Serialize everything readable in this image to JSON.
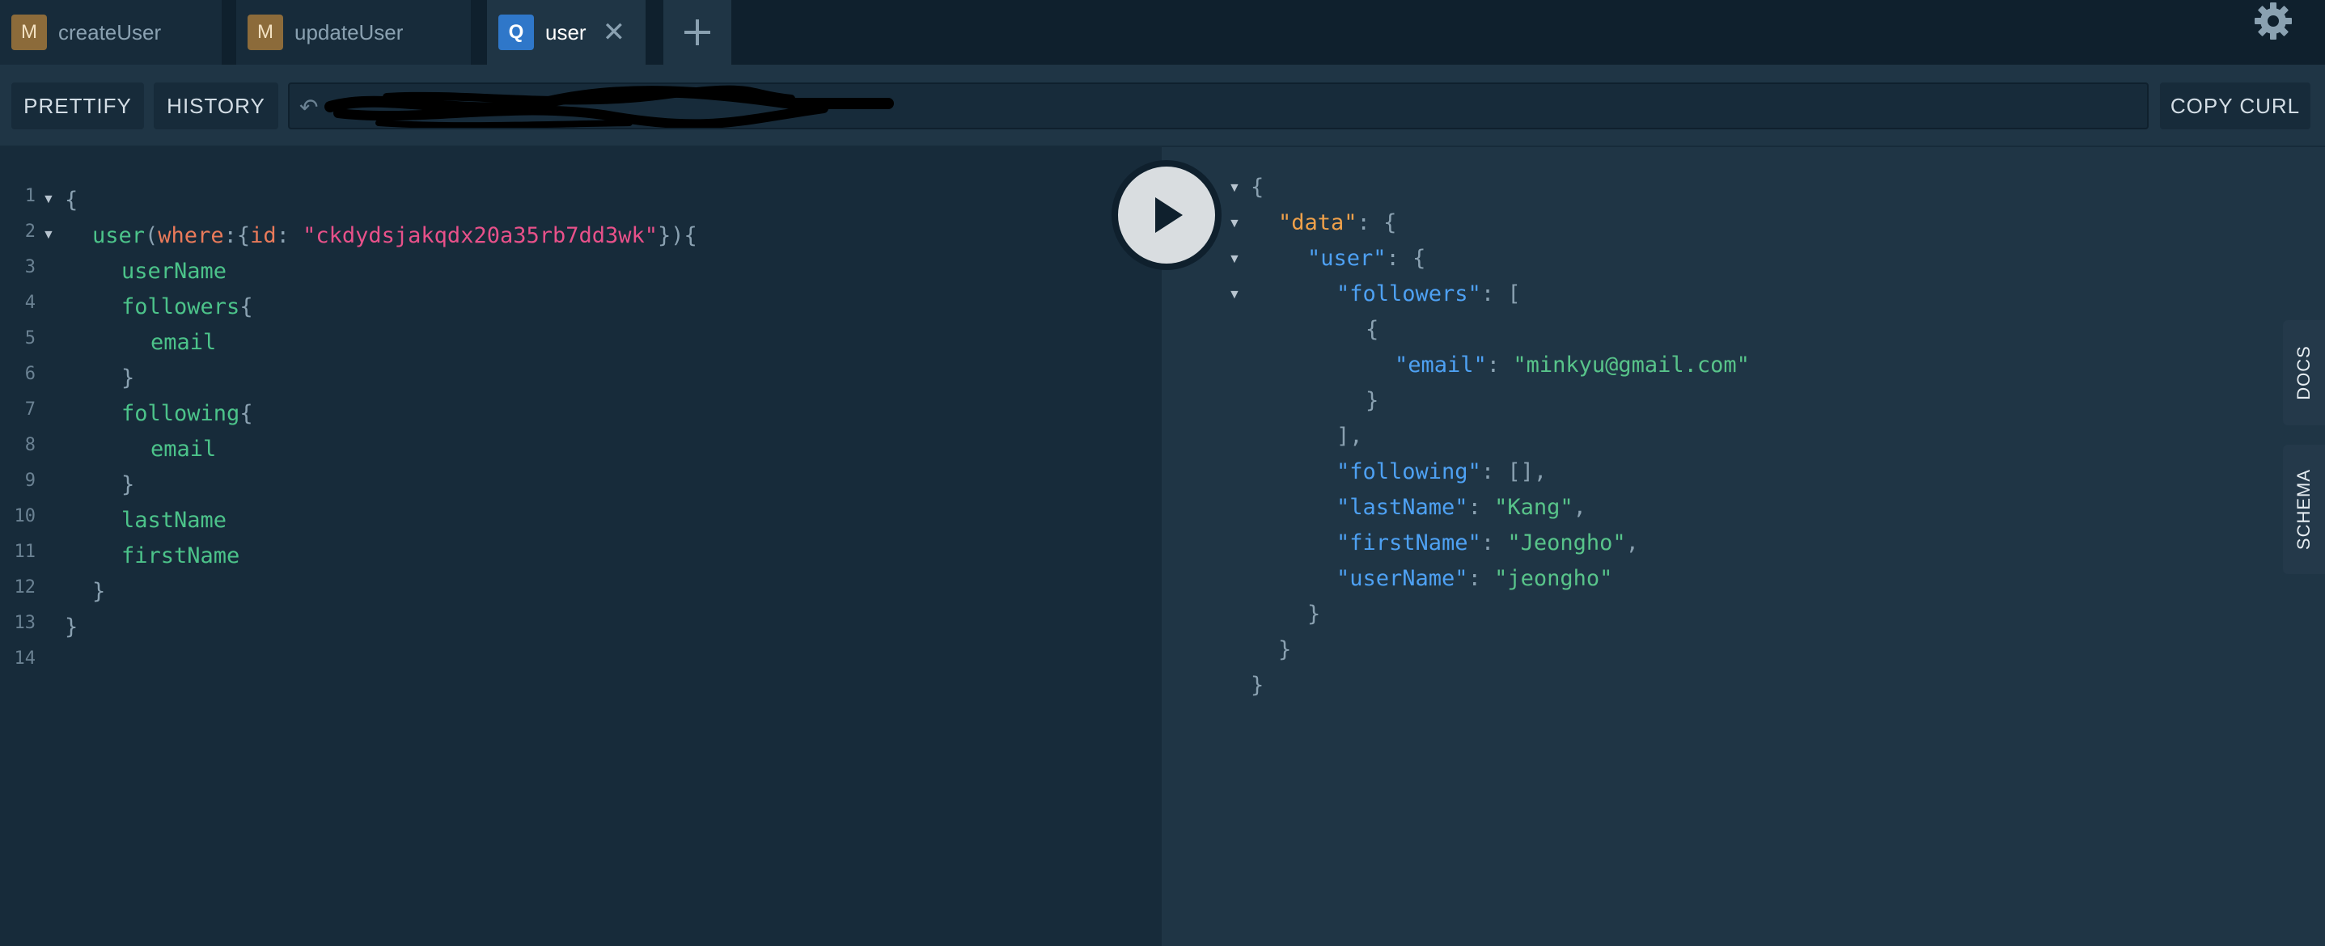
{
  "tabs": [
    {
      "badge": "M",
      "label": "createUser"
    },
    {
      "badge": "M",
      "label": "updateUser"
    },
    {
      "badge": "Q",
      "label": "user",
      "close": "✕"
    }
  ],
  "add_tab": "+",
  "toolbar": {
    "prettify": "PRETTIFY",
    "history": "HISTORY",
    "copy_curl": "COPY CURL"
  },
  "sidebar": {
    "docs": "DOCS",
    "schema": "SCHEMA"
  },
  "editor": {
    "line_numbers": [
      "1",
      "2",
      "3",
      "4",
      "5",
      "6",
      "7",
      "8",
      "9",
      "10",
      "11",
      "12",
      "13",
      "14"
    ],
    "lines": {
      "l1": "{",
      "l2": {
        "field": "user",
        "p1": "(",
        "arg": "where",
        "p2": ":{",
        "argkey": "id",
        "p3": ": ",
        "value": "\"ckdydsjakqdx20a35rb7dd3wk\"",
        "p4": "}){"
      },
      "l3": "userName",
      "l4a": "followers",
      "l4b": "{",
      "l5": "email",
      "l6": "}",
      "l7a": "following",
      "l7b": "{",
      "l8": "email",
      "l9": "}",
      "l10": "lastName",
      "l11": "firstName",
      "l12": "}",
      "l13": "}"
    }
  },
  "result": {
    "r1": "{",
    "data_key": "\"data\"",
    "sep": ": ",
    "open_brace": "{",
    "user_key": "\"user\"",
    "followers_key": "\"followers\"",
    "open_bracket": "[",
    "inner_open": "{",
    "email_key": "\"email\"",
    "email_val": "\"minkyu@gmail.com\"",
    "inner_close": "}",
    "close_bracket": "],",
    "following_key": "\"following\"",
    "following_val": "[],",
    "lastName_key": "\"lastName\"",
    "lastName_val": "\"Kang\"",
    "firstName_key": "\"firstName\"",
    "firstName_val": "\"Jeongho\"",
    "userName_key": "\"userName\"",
    "userName_val": "\"jeongho\"",
    "comma": ",",
    "close_user": "}",
    "close_data": "}",
    "close_root": "}"
  }
}
